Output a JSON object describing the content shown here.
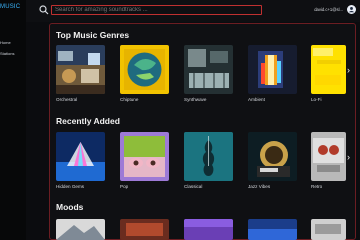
{
  "app": {
    "logo": "MUSIC",
    "nav": [
      "Home",
      "Stations"
    ]
  },
  "search": {
    "placeholder": "Search for amazing soundtracks ..."
  },
  "user": {
    "email": "david.c+1@sl..."
  },
  "sections": [
    {
      "title": "Top Music Genres",
      "items": [
        "Orchestral",
        "Chiptune",
        "Synthwave",
        "Ambient",
        "Lo-Fi"
      ]
    },
    {
      "title": "Recently Added",
      "items": [
        "Hidden Gems",
        "Pop",
        "Classical",
        "Jazz Vibes",
        "Retro"
      ]
    },
    {
      "title": "Moods",
      "items": [
        "",
        "",
        "",
        "",
        ""
      ]
    }
  ],
  "icons": {
    "search": "search-icon",
    "avatar": "user-avatar-icon",
    "next": "chevron-right-icon"
  },
  "colors": {
    "accent": "#c03030",
    "background": "#0b0c0f",
    "brand": "#3ab7ff"
  }
}
